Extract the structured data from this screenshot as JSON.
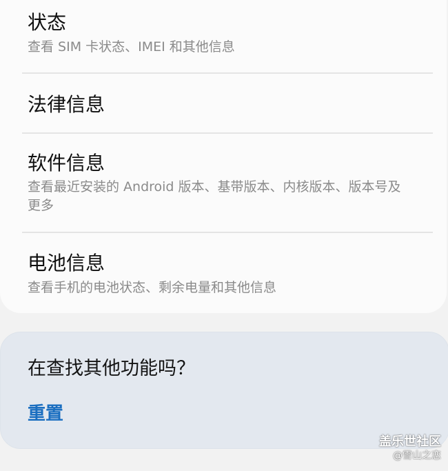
{
  "settings": {
    "items": [
      {
        "title": "状态",
        "subtitle": "查看 SIM 卡状态、IMEI 和其他信息"
      },
      {
        "title": "法律信息",
        "subtitle": ""
      },
      {
        "title": "软件信息",
        "subtitle": "查看最近安装的 Android 版本、基带版本、内核版本、版本号及更多"
      },
      {
        "title": "电池信息",
        "subtitle": "查看手机的电池状态、剩余电量和其他信息"
      }
    ]
  },
  "suggestion": {
    "title": "在查找其他功能吗？",
    "reset_label": "重置"
  },
  "watermark": {
    "brand": "盖乐世社区",
    "user": "@雪山之恋"
  },
  "colors": {
    "page_background": "#f2f2f2",
    "card_background": "#fbfbfb",
    "suggestion_background": "#e3e8ef",
    "link_accent": "#1a6ec0",
    "subtitle_text": "#8a8a8a"
  }
}
